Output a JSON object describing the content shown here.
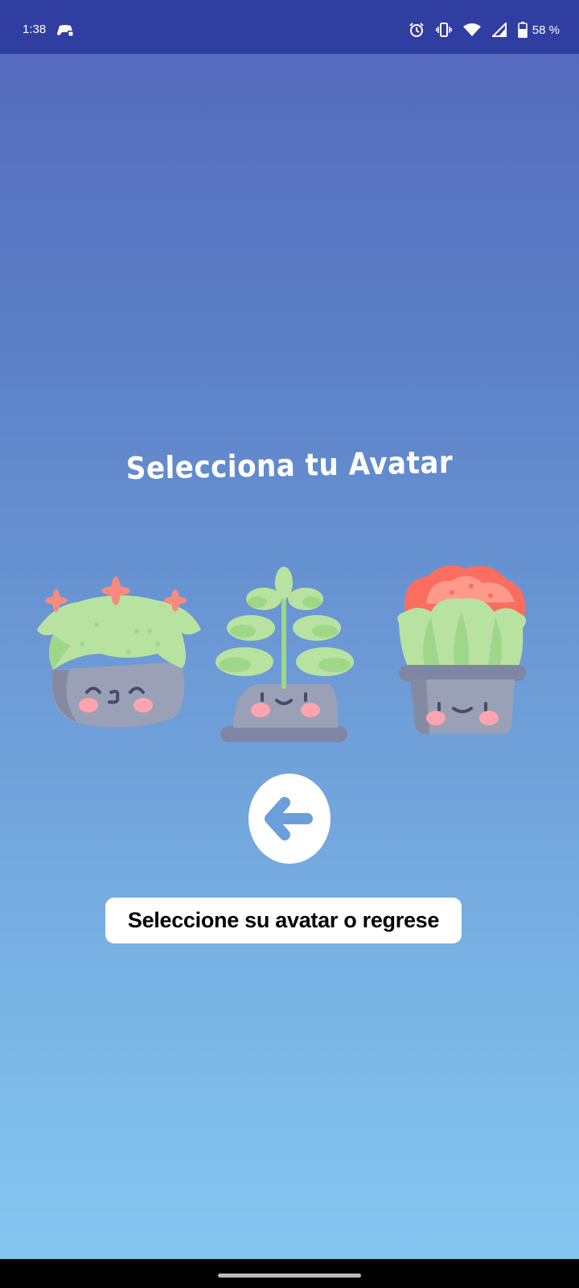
{
  "status_bar": {
    "time": "1:38",
    "battery": "58 %",
    "icons": [
      "game-controller-icon",
      "alarm-icon",
      "vibrate-icon",
      "wifi-icon",
      "signal-icon",
      "battery-icon"
    ]
  },
  "screen": {
    "title": "Selecciona tu Avatar",
    "avatars": [
      {
        "name": "flower-cactus-avatar"
      },
      {
        "name": "sprout-plant-avatar"
      },
      {
        "name": "red-flower-succulent-avatar"
      }
    ],
    "back_button_icon": "arrow-left-icon",
    "hint": "Seleccione su avatar o regrese"
  },
  "colors": {
    "status_bar": "#2f3ea0",
    "gradient_top": "#5467bb",
    "gradient_bottom": "#85c9f2",
    "arrow": "#6a9fdb"
  }
}
